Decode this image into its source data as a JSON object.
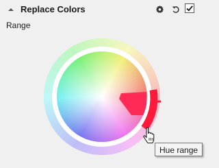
{
  "header": {
    "title": "Replace Colors",
    "collapse_icon": "triangle-up-icon",
    "settings_icon": "gear-icon",
    "reset_icon": "undo-icon",
    "enabled_checked": true
  },
  "range": {
    "label": "Range"
  },
  "hue_wheel": {
    "selected_hue_color": "#ff1a3c",
    "selection_fill_color": "#ff2a55"
  },
  "tooltip": {
    "text": "Hue range"
  },
  "cursor_icon": "hand-pointer-icon"
}
